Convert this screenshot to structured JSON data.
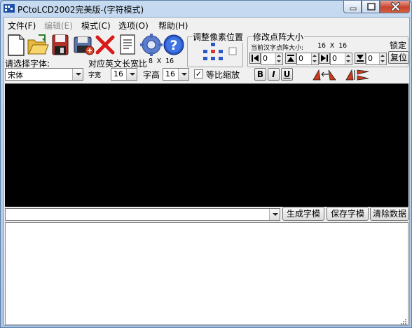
{
  "window": {
    "title": "PCtoLCD2002完美版-(字符模式)"
  },
  "menu": [
    {
      "label": "文件(F)",
      "enabled": true
    },
    {
      "label": "编辑(E)",
      "enabled": false
    },
    {
      "label": "模式(C)",
      "enabled": true
    },
    {
      "label": "选项(O)",
      "enabled": true
    },
    {
      "label": "帮助(H)",
      "enabled": true
    }
  ],
  "toolbar": {
    "icons": [
      "new-file-icon",
      "open-folder-icon",
      "save-disk-icon",
      "save-as-icon",
      "delete-x-icon",
      "notes-icon",
      "settings-gear-icon",
      "help-question-icon"
    ]
  },
  "font": {
    "label": "请选择字体:",
    "value": "宋体"
  },
  "char_size": {
    "label": "对应英文长宽比",
    "ratio": "8 X 16",
    "width_label": "字宽",
    "width_value": "16",
    "height_label": "字高",
    "height_value": "16",
    "proportional_label": "等比缩放",
    "proportional_checked": true
  },
  "pixel_position": {
    "title": "调整像素位置"
  },
  "dot_matrix": {
    "title": "修改点阵大小",
    "current_label": "当前汉字点阵大小:",
    "current_value": "16 X 16",
    "lock_label": "锁定",
    "restore_label": "复位",
    "spinners": [
      "0",
      "0",
      "0",
      "0"
    ]
  },
  "format": {
    "bold": "B",
    "italic": "I",
    "underline": "U"
  },
  "actions": {
    "generate": "生成字模",
    "save": "保存字模",
    "clear": "清除数据"
  },
  "input": {
    "value": ""
  },
  "output": {
    "text": ""
  },
  "colors": {
    "canvas": "#000000",
    "close_button": "#c7442e"
  }
}
